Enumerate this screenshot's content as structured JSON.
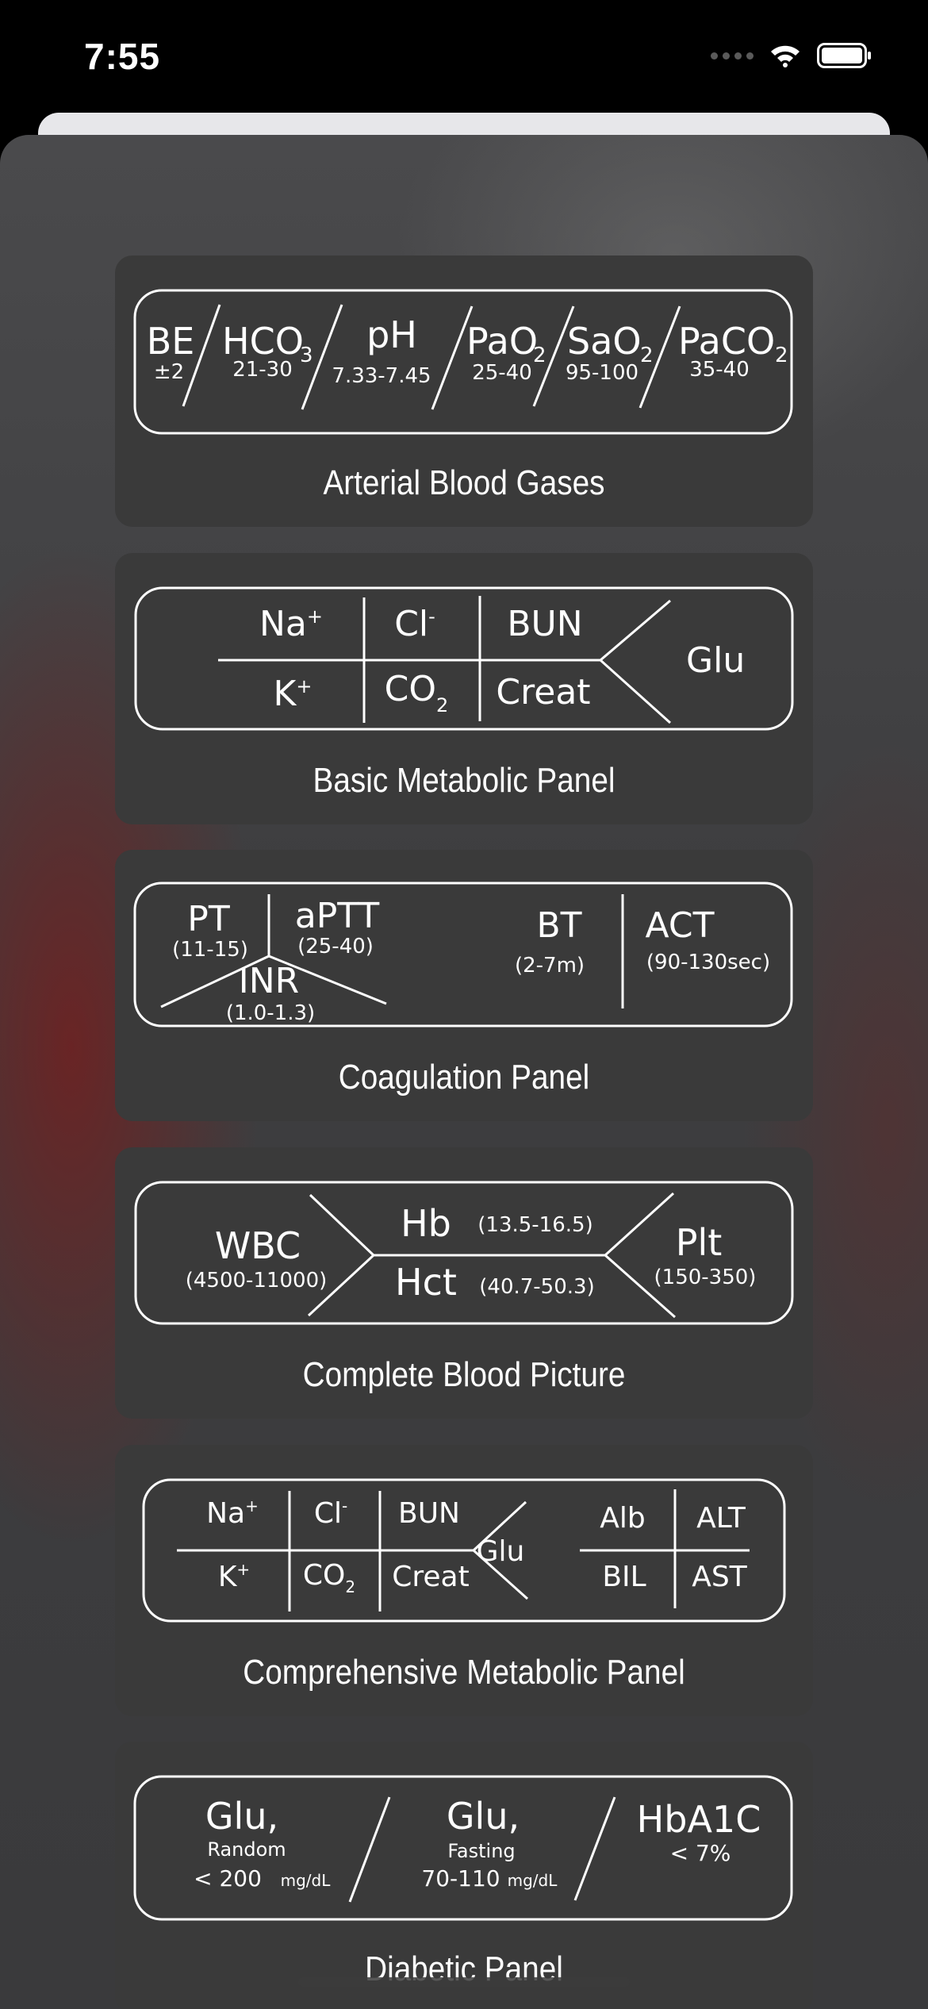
{
  "status_bar": {
    "time": "7:55",
    "icons": [
      "signal-dots-icon",
      "wifi-icon",
      "battery-icon"
    ]
  },
  "cards": {
    "abg": {
      "label": "Arterial Blood Gases",
      "items": [
        {
          "name": "BE",
          "range": "±2"
        },
        {
          "name": "HCO",
          "sub": "3",
          "range": "21-30"
        },
        {
          "name": "pH",
          "range": "7.33-7.45"
        },
        {
          "name": "PaO",
          "sub": "2",
          "range": "25-40"
        },
        {
          "name": "SaO",
          "sub": "2",
          "range": "95-100"
        },
        {
          "name": "PaCO",
          "sub": "2",
          "range": "35-40"
        }
      ]
    },
    "bmp": {
      "label": "Basic Metabolic Panel",
      "na": "Na",
      "na_sup": "+",
      "cl": "Cl",
      "cl_sup": "-",
      "bun": "BUN",
      "k": "K",
      "k_sup": "+",
      "co": "CO",
      "co_sub": "2",
      "creat": "Creat",
      "glu": "Glu"
    },
    "coag": {
      "label": "Coagulation Panel",
      "pt": "PT",
      "pt_range": "(11-15)",
      "aptt": "aPTT",
      "aptt_range": "(25-40)",
      "inr": "INR",
      "inr_range": "(1.0-1.3)",
      "bt": "BT",
      "bt_range": "(2-7m)",
      "act": "ACT",
      "act_range": "(90-130sec)"
    },
    "cbc": {
      "label": "Complete Blood Picture",
      "wbc": "WBC",
      "wbc_range": "(4500-11000)",
      "hb": "Hb",
      "hb_range": "(13.5-16.5)",
      "hct": "Hct",
      "hct_range": "(40.7-50.3)",
      "plt": "Plt",
      "plt_range": "(150-350)"
    },
    "cmp": {
      "label": "Comprehensive Metabolic Panel",
      "na": "Na",
      "na_sup": "+",
      "cl": "Cl",
      "cl_sup": "-",
      "bun": "BUN",
      "k": "K",
      "k_sup": "+",
      "co": "CO",
      "co_sub": "2",
      "creat": "Creat",
      "glu": "Glu",
      "alb": "Alb",
      "alt": "ALT",
      "bil": "BIL",
      "ast": "AST"
    },
    "diabetic": {
      "label": "Diabetic Panel",
      "glu_random": "Glu,",
      "random": "Random",
      "random_value": "< 200",
      "unit1": "mg/dL",
      "glu_fasting": "Glu,",
      "fasting": "Fasting",
      "fasting_value": "70-110",
      "unit2": "mg/dL",
      "hba1c": "HbA1C",
      "hba1c_value": "< 7%"
    }
  }
}
